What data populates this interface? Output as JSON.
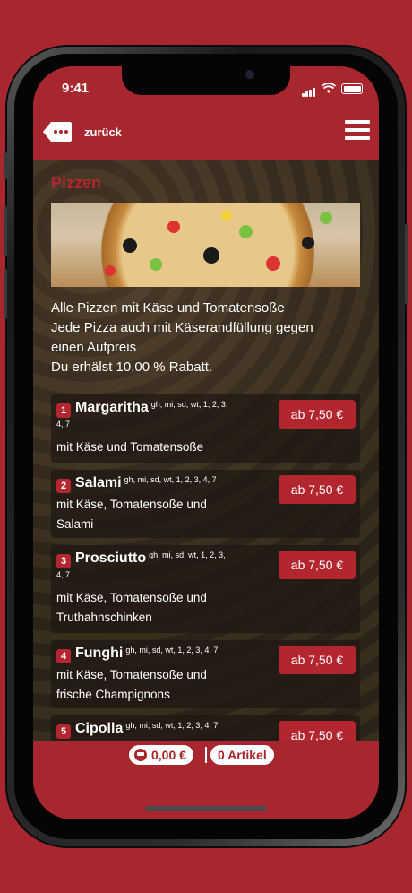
{
  "status_bar": {
    "time": "9:41"
  },
  "header": {
    "back_label": "zurück"
  },
  "category": {
    "title": "Pizzen",
    "description_lines": [
      "Alle Pizzen mit Käse und Tomatensoße",
      "Jede Pizza auch mit Käserandfüllung gegen",
      "einen Aufpreis",
      "Du erhälst 10,00 % Rabatt."
    ]
  },
  "items": [
    {
      "number": "1",
      "name": "Margaritha",
      "allergens": "gh, mi, sd, wt, 1, 2, 3,",
      "allergens_cont": "4, 7",
      "desc_lines": [
        "mit Käse und Tomatensoße"
      ],
      "price": "ab 7,50 €"
    },
    {
      "number": "2",
      "name": "Salami",
      "allergens": "gh, mi, sd, wt, 1, 2, 3, 4, 7",
      "allergens_cont": "",
      "desc_lines": [
        "mit Käse, Tomatensoße und",
        "Salami"
      ],
      "price": "ab 7,50 €"
    },
    {
      "number": "3",
      "name": "Prosciutto",
      "allergens": "gh, mi, sd, wt, 1, 2, 3,",
      "allergens_cont": "4, 7",
      "desc_lines": [
        "mit Käse, Tomatensoße und",
        "Truthahnschinken"
      ],
      "price": "ab 7,50 €"
    },
    {
      "number": "4",
      "name": "Funghi",
      "allergens": "gh, mi, sd, wt, 1, 2, 3, 4, 7",
      "allergens_cont": "",
      "desc_lines": [
        "mit Käse, Tomatensoße und",
        "frische Champignons"
      ],
      "price": "ab 7,50 €"
    },
    {
      "number": "5",
      "name": "Cipolla",
      "allergens": "gh, mi, sd, wt, 1, 2, 3, 4, 7",
      "allergens_cont": "",
      "desc_lines": [],
      "price": "ab 7,50 €"
    }
  ],
  "footer": {
    "cart_total": "0,00 €",
    "articles": "0 Artikel"
  },
  "colors": {
    "brand": "#a8262e",
    "accent": "#b3262f"
  }
}
